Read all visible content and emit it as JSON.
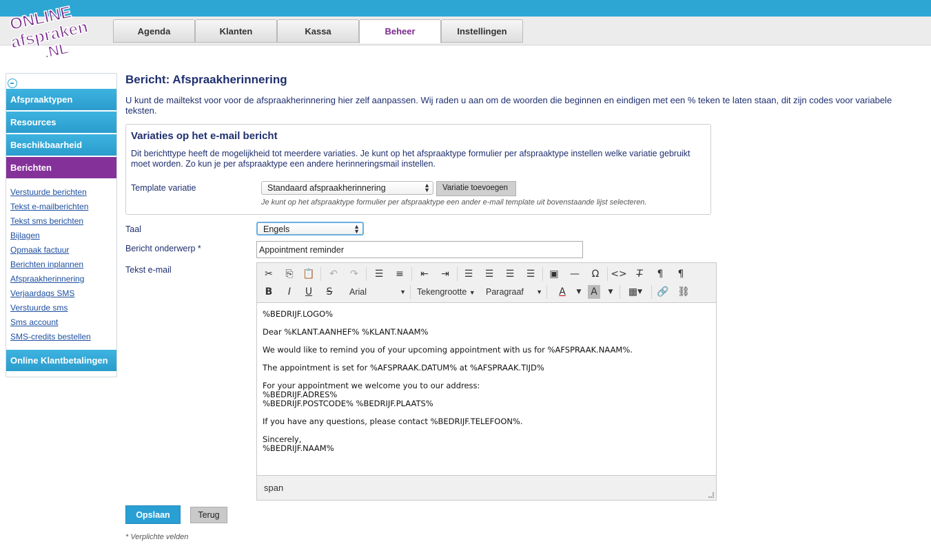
{
  "logo": {
    "line1": "ONLINE",
    "line2": "afspraken",
    ".nl": ".NL"
  },
  "nav": {
    "tabs": [
      {
        "label": "Agenda"
      },
      {
        "label": "Klanten"
      },
      {
        "label": "Kassa"
      },
      {
        "label": "Beheer"
      },
      {
        "label": "Instellingen"
      }
    ],
    "active": "Beheer"
  },
  "sidebar": {
    "sections": [
      {
        "label": "Afspraaktypen"
      },
      {
        "label": "Resources"
      },
      {
        "label": "Beschikbaarheid"
      },
      {
        "label": "Berichten"
      }
    ],
    "links": [
      {
        "label": "Verstuurde berichten"
      },
      {
        "label": "Tekst e-mailberichten"
      },
      {
        "label": "Tekst sms berichten"
      },
      {
        "label": "Bijlagen"
      },
      {
        "label": "Opmaak factuur"
      },
      {
        "label": "Berichten inplannen"
      },
      {
        "label": "Afspraakherinnering"
      },
      {
        "label": "Verjaardags SMS"
      },
      {
        "label": "Verstuurde sms"
      },
      {
        "label": "Sms account"
      },
      {
        "label": "SMS-credits bestellen"
      }
    ],
    "last_section": "Online Klantbetalingen"
  },
  "page": {
    "title": "Bericht: Afspraakherinnering",
    "intro": "U kunt de mailtekst voor voor de afspraakherinnering hier zelf aanpassen. Wij raden u aan om de woorden die beginnen en eindigen met een % teken te laten staan, dit zijn codes voor variabele teksten."
  },
  "variations": {
    "title": "Variaties op het e-mail bericht",
    "description": "Dit berichttype heeft de mogelijkheid tot meerdere variaties. Je kunt op het afspraaktype formulier per afspraaktype instellen welke variatie gebruikt moet worden. Zo kun je per afspraaktype een andere herinneringsmail instellen.",
    "template_label": "Template variatie",
    "template_value": "Standaard afspraakherinnering",
    "add_button": "Variatie toevoegen",
    "hint": "Je kunt op het afspraaktype formulier per afspraaktype een ander e-mail template uit bovenstaande lijst selecteren."
  },
  "form": {
    "language_label": "Taal",
    "language_value": "Engels",
    "subject_label": "Bericht onderwerp *",
    "subject_value": "Appointment reminder",
    "email_label": "Tekst e-mail"
  },
  "editor": {
    "font": "Arial",
    "fontsize": "Tekengrootte",
    "format": "Paragraaf",
    "body": [
      "%BEDRIJF.LOGO%",
      "Dear %KLANT.AANHEF% %KLANT.NAAM%",
      "We would like to remind you of your upcoming appointment with us for %AFSPRAAK.NAAM%.",
      "The appointment is set for %AFSPRAAK.DATUM% at %AFSPRAAK.TIJD%",
      "For your appointment we welcome you to our address:\n%BEDRIJF.ADRES%\n%BEDRIJF.POSTCODE% %BEDRIJF.PLAATS%",
      "If you have any questions, please contact %BEDRIJF.TELEFOON%.",
      "Sincerely,\n%BEDRIJF.NAAM%"
    ],
    "status": "span"
  },
  "actions": {
    "save": "Opslaan",
    "back": "Terug",
    "required_note": "* Verplichte velden"
  },
  "colors": {
    "brand_blue": "#2ea6d4",
    "brand_purple": "#85319a",
    "text_navy": "#1f2f6f"
  }
}
